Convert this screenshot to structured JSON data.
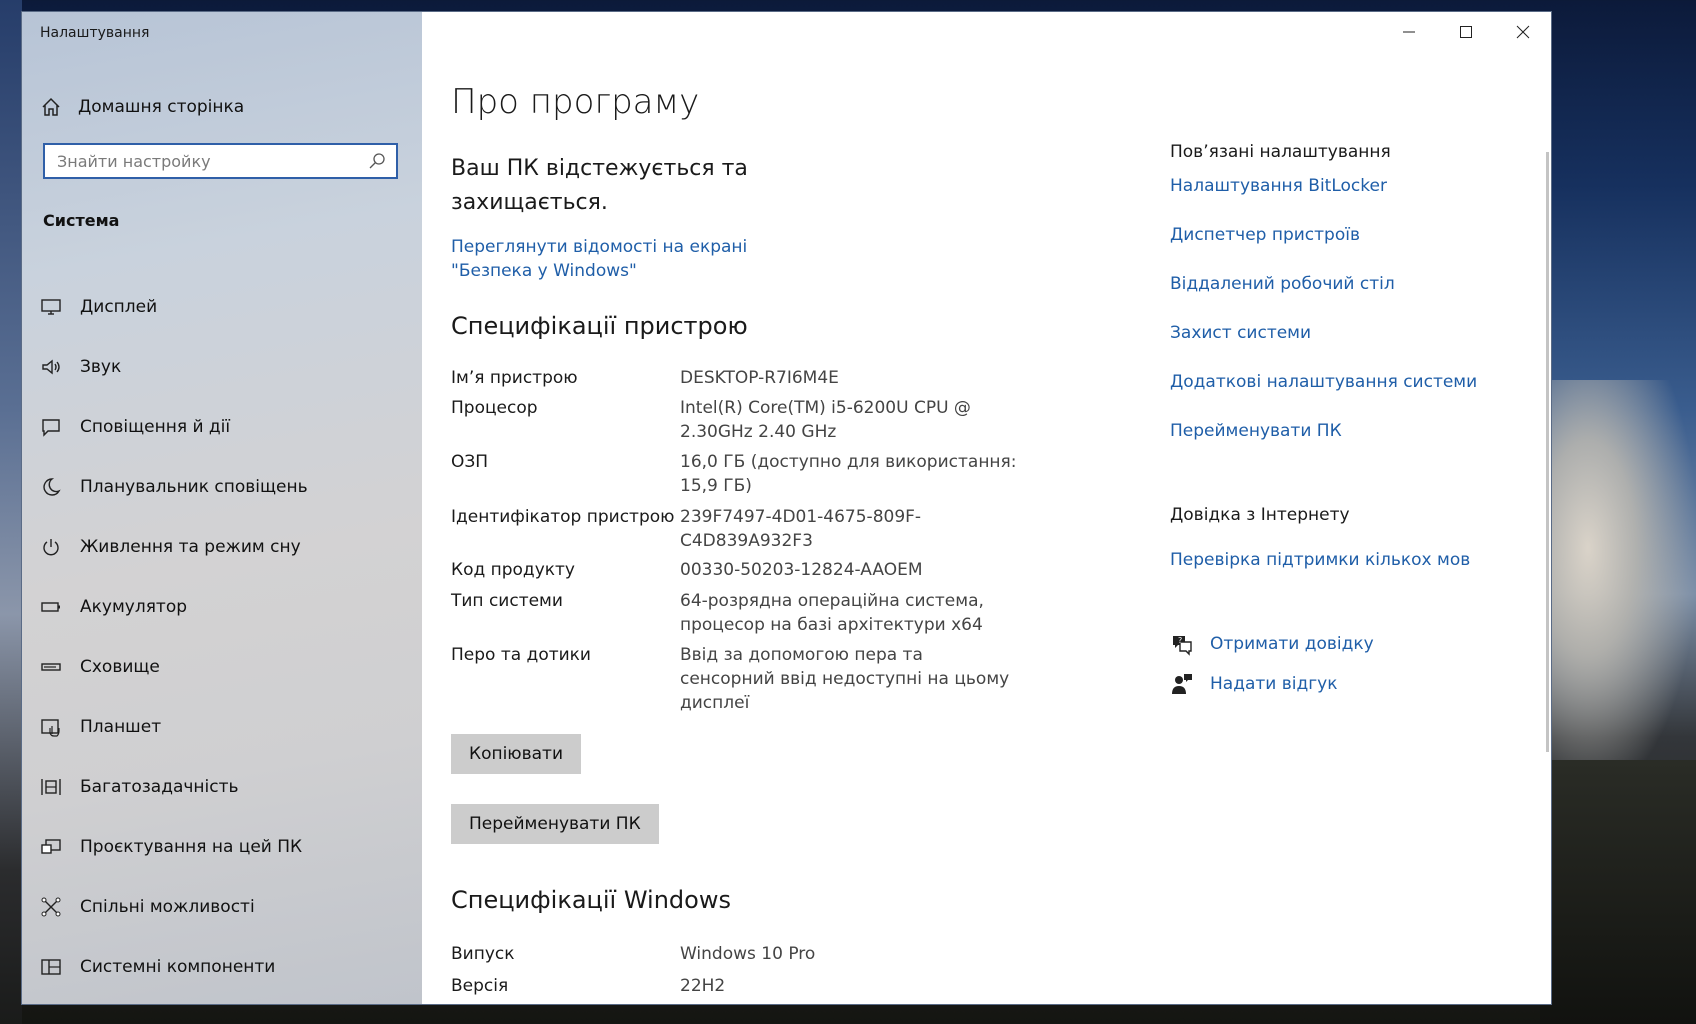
{
  "window": {
    "title": "Налаштування"
  },
  "sidebar": {
    "home_label": "Домашня сторінка",
    "search_placeholder": "Знайти настройку",
    "section_title": "Система",
    "items": [
      {
        "label": "Дисплей",
        "icon": "display-icon"
      },
      {
        "label": "Звук",
        "icon": "speaker-icon"
      },
      {
        "label": "Сповіщення й дії",
        "icon": "notification-icon"
      },
      {
        "label": "Планувальник сповіщень",
        "icon": "moon-icon"
      },
      {
        "label": "Живлення та режим сну",
        "icon": "power-icon"
      },
      {
        "label": "Акумулятор",
        "icon": "battery-icon"
      },
      {
        "label": "Сховище",
        "icon": "storage-icon"
      },
      {
        "label": "Планшет",
        "icon": "tablet-icon"
      },
      {
        "label": "Багатозадачність",
        "icon": "multitasking-icon"
      },
      {
        "label": "Проєктування на цей ПК",
        "icon": "projecting-icon"
      },
      {
        "label": "Спільні можливості",
        "icon": "shared-experiences-icon"
      },
      {
        "label": "Системні компоненти",
        "icon": "system-components-icon"
      }
    ]
  },
  "main": {
    "title": "Про програму",
    "status": "Ваш ПК відстежується та захищається.",
    "security_link": "Переглянути відомості на екрані \"Безпека у Windows\"",
    "device_specs": {
      "heading": "Специфікації пристрою",
      "rows": [
        {
          "key": "Ім’я пристрою",
          "value": "DESKTOP-R7I6M4E"
        },
        {
          "key": "Процесор",
          "value": "Intel(R) Core(TM) i5-6200U CPU @ 2.30GHz   2.40 GHz"
        },
        {
          "key": "ОЗП",
          "value": "16,0 ГБ (доступно для використання: 15,9 ГБ)"
        },
        {
          "key": "Ідентифікатор пристрою",
          "value": "239F7497-4D01-4675-809F-C4D839A932F3"
        },
        {
          "key": "Код продукту",
          "value": "00330-50203-12824-AAOEM"
        },
        {
          "key": "Тип системи",
          "value": "64-розрядна операційна система, процесор на базі архітектури x64"
        },
        {
          "key": "Перо та дотики",
          "value": "Ввід за допомогою пера та сенсорний ввід недоступні на цьому дисплеї"
        }
      ],
      "copy_button": "Копіювати",
      "rename_button": "Перейменувати ПК"
    },
    "windows_specs": {
      "heading": "Специфікації Windows",
      "rows": [
        {
          "key": "Випуск",
          "value": "Windows 10 Pro"
        },
        {
          "key": "Версія",
          "value": "22H2"
        }
      ]
    }
  },
  "related": {
    "heading": "Пов’язані налаштування",
    "links": [
      "Налаштування BitLocker",
      "Диспетчер пристроїв",
      "Віддалений робочий стіл",
      "Захист системи",
      "Додаткові налаштування системи",
      "Перейменувати ПК"
    ],
    "web_help_heading": "Довідка з Інтернету",
    "web_help_link": "Перевірка підтримки кількох мов",
    "get_help": "Отримати довідку",
    "feedback": "Надати відгук"
  },
  "colors": {
    "accent": "#1f5ea8",
    "search_border": "#2f5fa8",
    "button_bg": "#cccccc"
  }
}
